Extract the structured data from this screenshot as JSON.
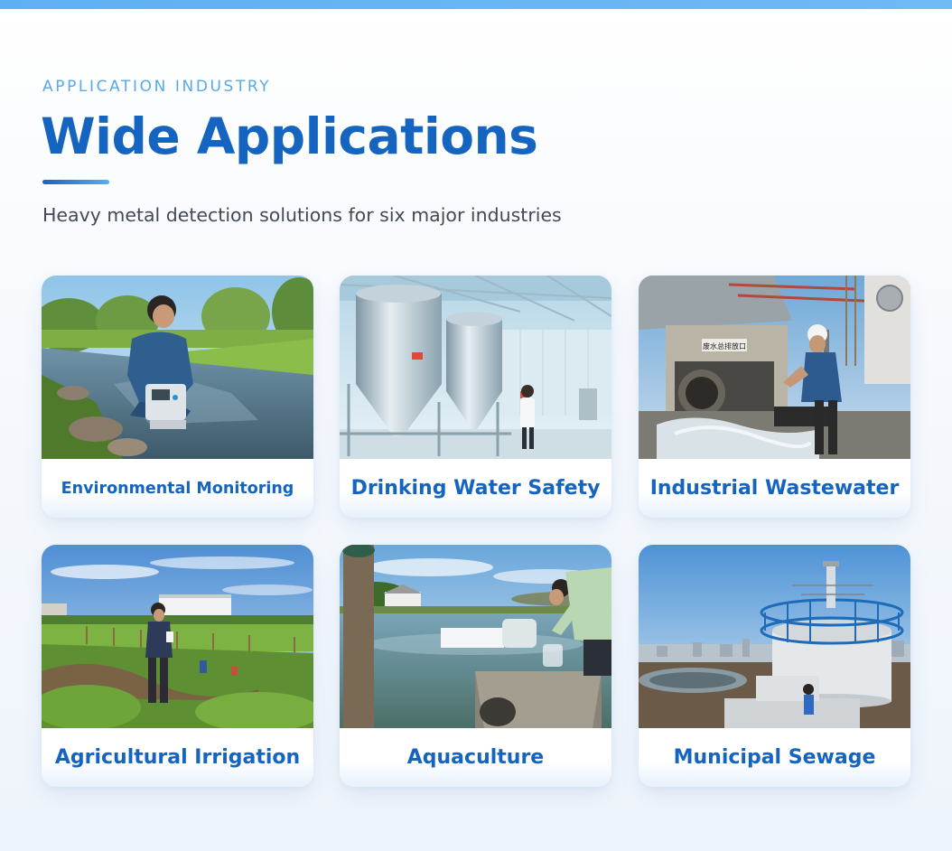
{
  "header": {
    "eyebrow": "APPLICATION INDUSTRY",
    "title": "Wide Applications",
    "subtitle": "Heavy metal detection solutions for six major industries"
  },
  "colors": {
    "top_bar": "#5fb0f3",
    "eyebrow": "#5aa8e8",
    "title": "#1565c0",
    "subtitle": "#424a55",
    "card_label": "#1565c0"
  },
  "cards": [
    {
      "label": "Environmental Monitoring",
      "image": "river-sampling-photo"
    },
    {
      "label": "Drinking Water Safety",
      "image": "water-plant-tanks-photo"
    },
    {
      "label": "Industrial Wastewater",
      "image": "wastewater-outlet-photo"
    },
    {
      "label": "Agricultural Irrigation",
      "image": "farm-field-photo"
    },
    {
      "label": "Aquaculture",
      "image": "fish-pond-photo"
    },
    {
      "label": "Municipal Sewage",
      "image": "sewage-plant-photo"
    }
  ],
  "sign_text": "废水总排放口"
}
